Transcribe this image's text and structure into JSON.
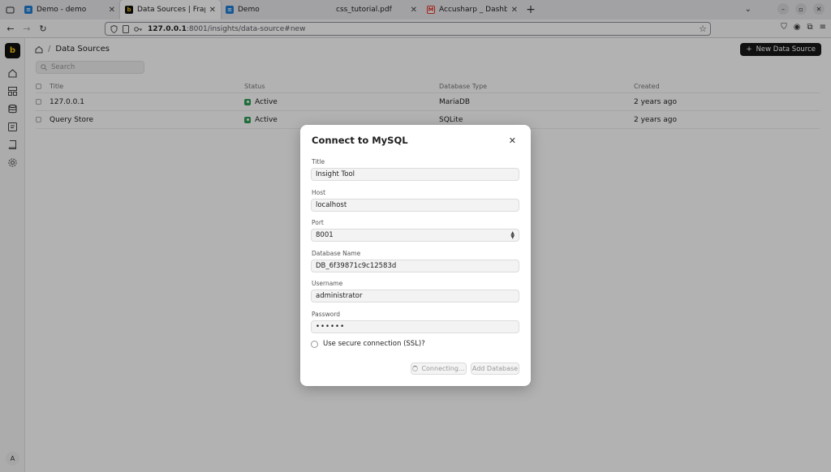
{
  "browser": {
    "tabs": [
      {
        "label": "Demo - demo",
        "favicon_color": "#1f7fd6",
        "active": false
      },
      {
        "label": "Data Sources | Frappe Ins",
        "favicon_color": "#111111",
        "active": true
      },
      {
        "label": "Demo",
        "favicon_color": "#1f7fd6",
        "active": false
      },
      {
        "label": "css_tutorial.pdf",
        "favicon_color": "",
        "active": false
      },
      {
        "label": "Accusharp _ Dashboard ",
        "favicon_color": "#d93025",
        "active": false
      }
    ],
    "url_host": "127.0.0.1",
    "url_path": ":8001/insights/data-source#new"
  },
  "sidebar": {
    "logo_glyph": "[b]",
    "avatar_initial": "A",
    "icons": [
      "home-icon",
      "dashboard-icon",
      "database-icon",
      "query-icon",
      "notebook-icon",
      "settings-icon"
    ]
  },
  "page": {
    "breadcrumb_title": "Data Sources",
    "new_button_label": "New Data Source",
    "search_placeholder": "Search",
    "columns": [
      "Title",
      "Status",
      "Database Type",
      "Created"
    ],
    "rows": [
      {
        "title": "127.0.0.1",
        "status": "Active",
        "db_type": "MariaDB",
        "created": "2 years ago"
      },
      {
        "title": "Query Store",
        "status": "Active",
        "db_type": "SQLite",
        "created": "2 years ago"
      }
    ],
    "status_color": "#2e9e57"
  },
  "modal": {
    "title": "Connect to MySQL",
    "fields": [
      {
        "label": "Title",
        "value": "Insight Tool"
      },
      {
        "label": "Host",
        "value": "localhost"
      },
      {
        "label": "Port",
        "value": "8001"
      },
      {
        "label": "Database Name",
        "value": "DB_6f39871c9c12583d"
      },
      {
        "label": "Username",
        "value": "administrator"
      },
      {
        "label": "Password",
        "value": "••••••"
      }
    ],
    "ssl_label": "Use secure connection (SSL)?",
    "connecting_label": "Connecting...",
    "add_label": "Add Database"
  }
}
